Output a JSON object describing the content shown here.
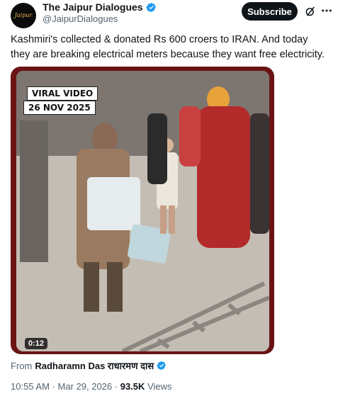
{
  "header": {
    "display_name": "The Jaipur Dialogues",
    "handle": "@JaipurDialogues",
    "avatar_text": "Jaipur",
    "subscribe_label": "Subscribe"
  },
  "tweet": {
    "text": "Kashmiri's collected & donated Rs 600 croers to IRAN. And today they are breaking electrical meters because they want free electricity."
  },
  "media": {
    "badge_title": "VIRAL VIDEO",
    "badge_date": "26 NOV 2025",
    "duration": "0:12"
  },
  "attribution": {
    "prefix": "From",
    "author": "Radharamn Das राधारमण दास"
  },
  "meta": {
    "time": "10:55 AM",
    "separator": "·",
    "date": "Mar 29, 2026",
    "views_count": "93.5K",
    "views_label": "Views"
  },
  "colors": {
    "verified_blue": "#1d9bf0",
    "media_border": "#6b1414",
    "text_secondary": "#536471"
  }
}
